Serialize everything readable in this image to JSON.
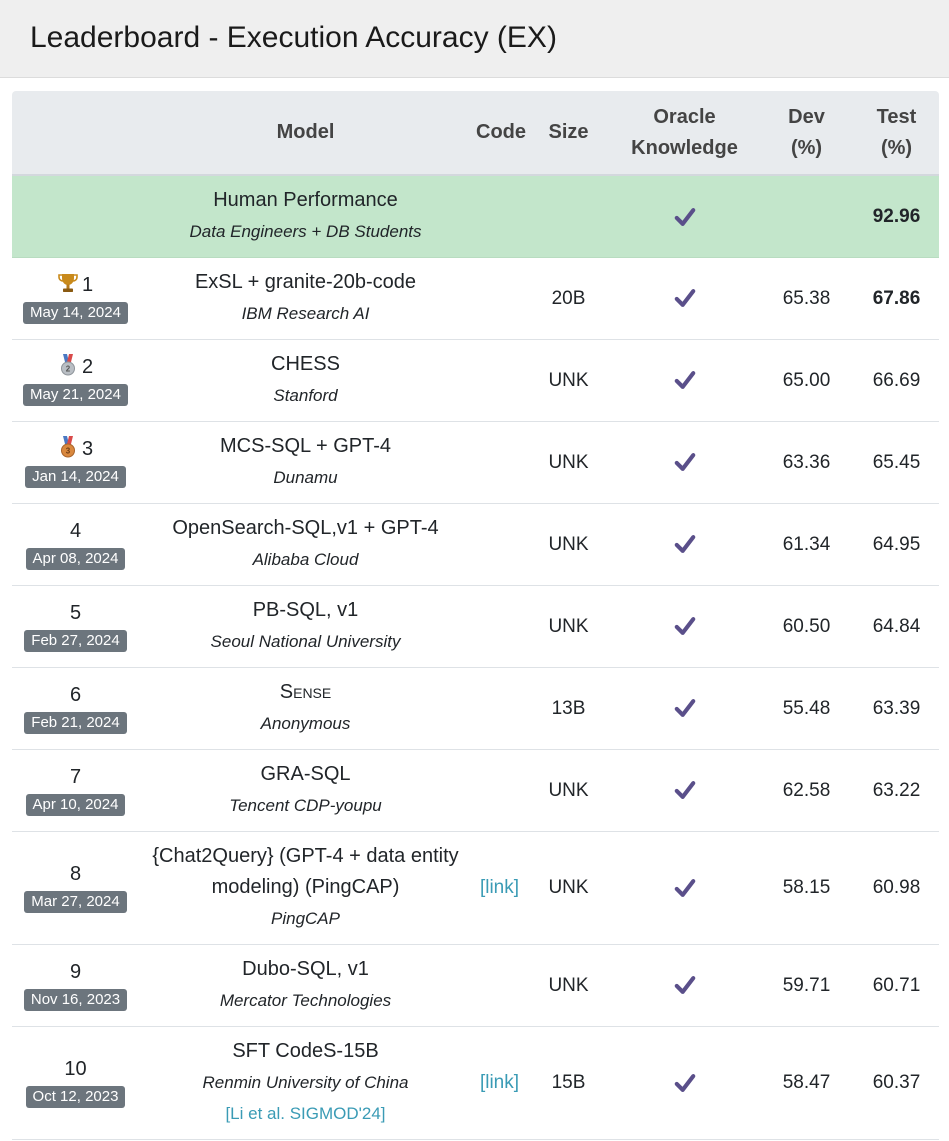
{
  "title": "Leaderboard - Execution Accuracy (EX)",
  "columns": {
    "model": "Model",
    "code": "Code",
    "size": "Size",
    "oracle_line1": "Oracle",
    "oracle_line2": "Knowledge",
    "dev_line1": "Dev",
    "dev_line2": "(%)",
    "test_line1": "Test",
    "test_line2": "(%)"
  },
  "human": {
    "model": "Human Performance",
    "org": "Data Engineers + DB Students",
    "test": "92.96"
  },
  "rows": [
    {
      "rank": "1",
      "medal": "trophy-icon",
      "date": "May 14, 2024",
      "model": "ExSL + granite-20b-code",
      "org": "IBM Research AI",
      "code": "",
      "size": "20B",
      "dev": "65.38",
      "test": "67.86"
    },
    {
      "rank": "2",
      "medal": "silver-medal-icon",
      "date": "May 21, 2024",
      "model": "CHESS",
      "org": "Stanford",
      "code": "",
      "size": "UNK",
      "dev": "65.00",
      "test": "66.69"
    },
    {
      "rank": "3",
      "medal": "bronze-medal-icon",
      "date": "Jan 14, 2024",
      "model": "MCS-SQL + GPT-4",
      "org": "Dunamu",
      "code": "",
      "size": "UNK",
      "dev": "63.36",
      "test": "65.45"
    },
    {
      "rank": "4",
      "date": "Apr 08, 2024",
      "model": "OpenSearch-SQL,v1 + GPT-4",
      "org": "Alibaba Cloud",
      "code": "",
      "size": "UNK",
      "dev": "61.34",
      "test": "64.95"
    },
    {
      "rank": "5",
      "date": "Feb 27, 2024",
      "model": "PB-SQL, v1",
      "org": "Seoul National University",
      "code": "",
      "size": "UNK",
      "dev": "60.50",
      "test": "64.84"
    },
    {
      "rank": "6",
      "date": "Feb 21, 2024",
      "model": "Sense",
      "org": "Anonymous",
      "code": "",
      "size": "13B",
      "dev": "55.48",
      "test": "63.39"
    },
    {
      "rank": "7",
      "date": "Apr 10, 2024",
      "model": "GRA-SQL",
      "org": "Tencent CDP-youpu",
      "code": "",
      "size": "UNK",
      "dev": "62.58",
      "test": "63.22"
    },
    {
      "rank": "8",
      "date": "Mar 27, 2024",
      "model": "{Chat2Query} (GPT-4 + data entity modeling) (PingCAP)",
      "org": "PingCAP",
      "code": "[link]",
      "size": "UNK",
      "dev": "58.15",
      "test": "60.98"
    },
    {
      "rank": "9",
      "date": "Nov 16, 2023",
      "model": "Dubo-SQL, v1",
      "org": "Mercator Technologies",
      "code": "",
      "size": "UNK",
      "dev": "59.71",
      "test": "60.71"
    },
    {
      "rank": "10",
      "date": "Oct 12, 2023",
      "model": "SFT CodeS-15B",
      "org": "Renmin University of China",
      "paper": "[Li et al. SIGMOD'24]",
      "code": "[link]",
      "size": "15B",
      "dev": "58.47",
      "test": "60.37"
    }
  ],
  "colors": {
    "human_row_bg": "#c3e6cb",
    "header_bg": "#e8ebee",
    "date_badge_bg": "#6c757d",
    "check_color": "#5a4f8a",
    "link_color": "#3a9bb5"
  }
}
